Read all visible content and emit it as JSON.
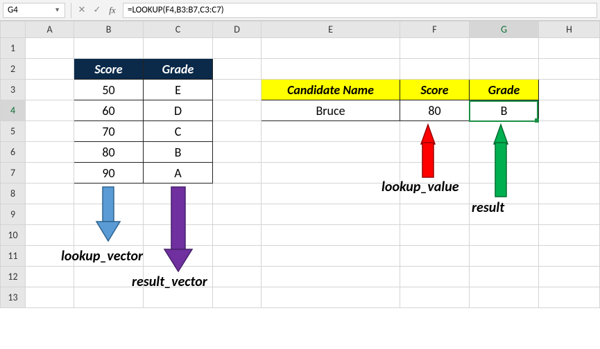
{
  "name_box": "G4",
  "formula": "=LOOKUP(F4,B3:B7,C3:C7)",
  "icons": {
    "cancel": "✕",
    "confirm": "✓",
    "fx": "fx",
    "dropdown": "▼"
  },
  "columns": [
    "A",
    "B",
    "C",
    "D",
    "E",
    "F",
    "G",
    "H"
  ],
  "rows": [
    "1",
    "2",
    "3",
    "4",
    "5",
    "6",
    "7",
    "8",
    "9",
    "10",
    "11",
    "12",
    "13"
  ],
  "lookup_table": {
    "headers": {
      "score": "Score",
      "grade": "Grade"
    },
    "rows": [
      {
        "score": "50",
        "grade": "E"
      },
      {
        "score": "60",
        "grade": "D"
      },
      {
        "score": "70",
        "grade": "C"
      },
      {
        "score": "80",
        "grade": "B"
      },
      {
        "score": "90",
        "grade": "A"
      }
    ]
  },
  "candidate": {
    "headers": {
      "name": "Candidate Name",
      "score": "Score",
      "grade": "Grade"
    },
    "row": {
      "name": "Bruce",
      "score": "80",
      "grade": "B"
    }
  },
  "annotations": {
    "lookup_vector": "lookup_vector",
    "result_vector": "result_vector",
    "lookup_value": "lookup_value",
    "result": "result"
  },
  "colors": {
    "arrow_blue": "#5b9bd5",
    "arrow_purple": "#7030a0",
    "arrow_red": "#ff0000",
    "arrow_green": "#00b050"
  }
}
